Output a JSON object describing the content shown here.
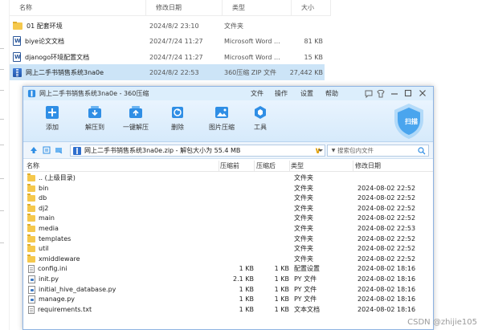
{
  "explorer": {
    "columns": {
      "name": "名称",
      "date": "修改日期",
      "type": "类型",
      "size": "大小"
    },
    "rows": [
      {
        "name": "01 配套环境",
        "date": "2024/8/2 23:10",
        "type": "文件夹",
        "size": "",
        "icon": "folder-icon"
      },
      {
        "name": "biye论文文档",
        "date": "2024/7/24 11:27",
        "type": "Microsoft Word ...",
        "size": "81 KB",
        "icon": "word-doc-icon"
      },
      {
        "name": "djanogo环境配置文档",
        "date": "2024/7/24 11:27",
        "type": "Microsoft Word ...",
        "size": "15 KB",
        "icon": "word-doc-icon"
      },
      {
        "name": "网上二手书销售系统3na0e",
        "date": "2024/8/2 22:53",
        "type": "360压缩 ZIP 文件",
        "size": "27,442 KB",
        "icon": "zip-icon"
      }
    ]
  },
  "window": {
    "title": "网上二手书销售系统3na0e - 360压缩",
    "menu": [
      "文件",
      "操作",
      "设置",
      "帮助"
    ],
    "toolbar": [
      {
        "label": "添加",
        "icon": "add-icon"
      },
      {
        "label": "解压到",
        "icon": "extract-to-icon"
      },
      {
        "label": "一键解压",
        "icon": "one-click-extract-icon"
      },
      {
        "label": "删除",
        "icon": "delete-icon"
      },
      {
        "label": "图片压缩",
        "icon": "image-compress-icon"
      },
      {
        "label": "工具",
        "icon": "tools-icon"
      }
    ],
    "brand_label": "扫描",
    "address": "网上二手书销售系统3na0e.zip - 解包大小为 55.4 MB",
    "search_placeholder": "搜索包内文件",
    "list_columns": {
      "name": "名称",
      "compressed": "压缩前",
      "after": "压缩后",
      "type": "类型",
      "date": "修改日期"
    },
    "files": [
      {
        "name": ".. (上级目录)",
        "before": "",
        "after": "",
        "type": "文件夹",
        "date": "",
        "kind": "folder"
      },
      {
        "name": "bin",
        "before": "",
        "after": "",
        "type": "文件夹",
        "date": "2024-08-02 22:52",
        "kind": "folder"
      },
      {
        "name": "db",
        "before": "",
        "after": "",
        "type": "文件夹",
        "date": "2024-08-02 22:52",
        "kind": "folder"
      },
      {
        "name": "dj2",
        "before": "",
        "after": "",
        "type": "文件夹",
        "date": "2024-08-02 22:52",
        "kind": "folder"
      },
      {
        "name": "main",
        "before": "",
        "after": "",
        "type": "文件夹",
        "date": "2024-08-02 22:52",
        "kind": "folder"
      },
      {
        "name": "media",
        "before": "",
        "after": "",
        "type": "文件夹",
        "date": "2024-08-02 22:53",
        "kind": "folder"
      },
      {
        "name": "templates",
        "before": "",
        "after": "",
        "type": "文件夹",
        "date": "2024-08-02 22:52",
        "kind": "folder"
      },
      {
        "name": "util",
        "before": "",
        "after": "",
        "type": "文件夹",
        "date": "2024-08-02 22:52",
        "kind": "folder"
      },
      {
        "name": "xmiddleware",
        "before": "",
        "after": "",
        "type": "文件夹",
        "date": "2024-08-02 22:52",
        "kind": "folder"
      },
      {
        "name": "config.ini",
        "before": "1 KB",
        "after": "1 KB",
        "type": "配置设置",
        "date": "2024-08-02 18:16",
        "kind": "ini"
      },
      {
        "name": "init.py",
        "before": "2.1 KB",
        "after": "1 KB",
        "type": "PY 文件",
        "date": "2024-08-02 18:16",
        "kind": "py"
      },
      {
        "name": "initial_hive_database.py",
        "before": "1 KB",
        "after": "1 KB",
        "type": "PY 文件",
        "date": "2024-08-02 18:16",
        "kind": "py"
      },
      {
        "name": "manage.py",
        "before": "1 KB",
        "after": "1 KB",
        "type": "PY 文件",
        "date": "2024-08-02 18:16",
        "kind": "py"
      },
      {
        "name": "requirements.txt",
        "before": "1 KB",
        "after": "1 KB",
        "type": "文本文档",
        "date": "2024-08-02 18:16",
        "kind": "txt"
      }
    ]
  },
  "watermark": "CSDN @zhijie105",
  "colors": {
    "accent": "#2f8ee5",
    "selected_row": "#cce4f7",
    "folder": "#f5c84c"
  }
}
